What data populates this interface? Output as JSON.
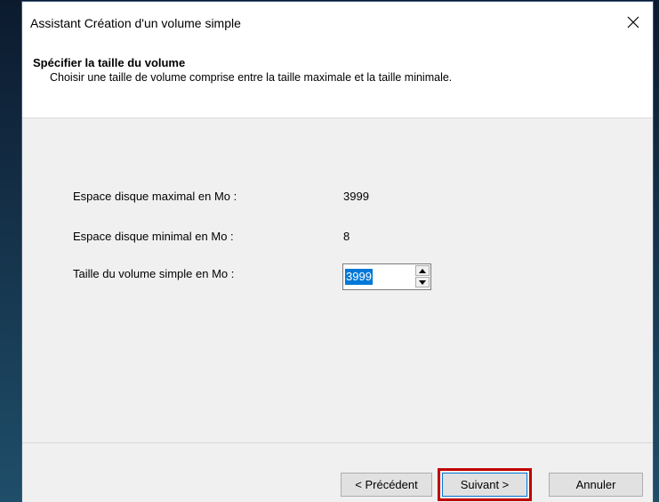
{
  "window": {
    "title": "Assistant Création d'un volume simple",
    "close_glyph": "✕"
  },
  "header": {
    "title": "Spécifier la taille du volume",
    "subtitle": "Choisir une taille de volume comprise entre la taille maximale et la taille minimale."
  },
  "form": {
    "max_label": "Espace disque maximal en Mo :",
    "max_value": "3999",
    "min_label": "Espace disque minimal en Mo :",
    "min_value": "8",
    "size_label": "Taille du volume simple en Mo :",
    "size_value": "3999"
  },
  "buttons": {
    "prev": "< Précédent",
    "next": "Suivant >",
    "cancel": "Annuler"
  },
  "colors": {
    "selection": "#0078d7",
    "highlight_box": "#c00000"
  }
}
